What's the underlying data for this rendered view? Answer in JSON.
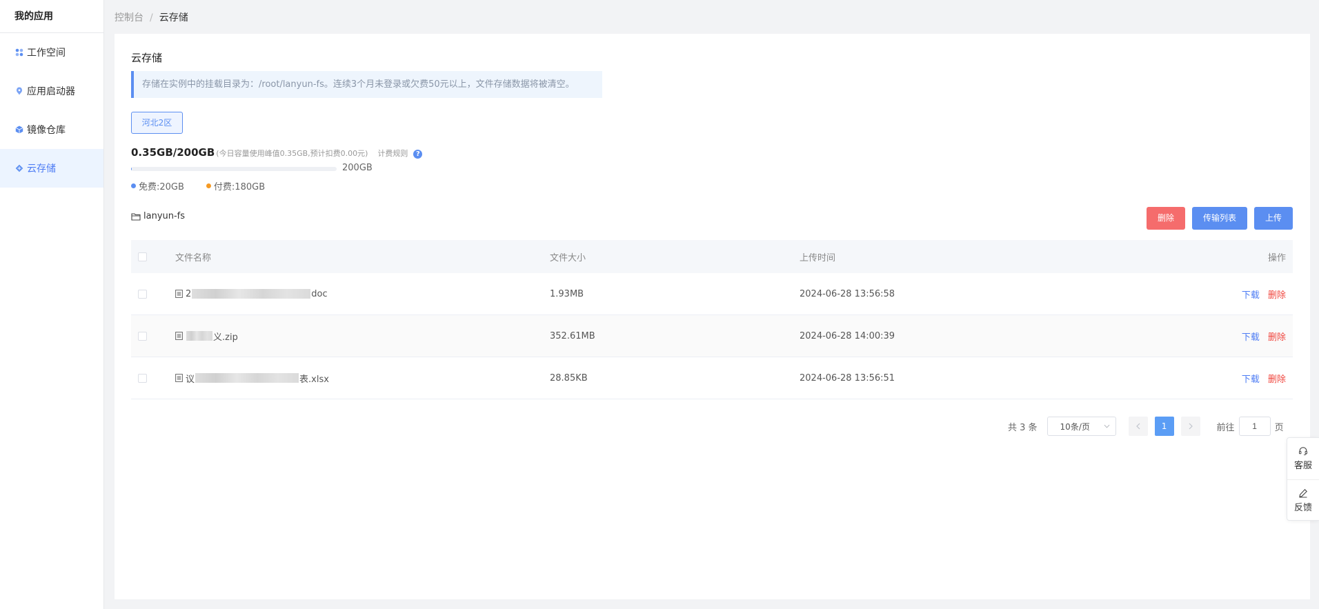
{
  "sidebar": {
    "title": "我的应用",
    "items": [
      {
        "label": "工作空间",
        "icon": "workspace-icon",
        "active": false
      },
      {
        "label": "应用启动器",
        "icon": "launcher-icon",
        "active": false
      },
      {
        "label": "镜像仓库",
        "icon": "image-repo-icon",
        "active": false
      },
      {
        "label": "云存储",
        "icon": "cloud-storage-icon",
        "active": true
      }
    ]
  },
  "breadcrumb": {
    "root": "控制台",
    "separator": "/",
    "current": "云存储"
  },
  "page": {
    "title": "云存储",
    "notice": "存储在实例中的挂载目录为：/root/lanyun-fs。连续3个月未登录或欠费50元以上，文件存储数据将被清空。",
    "region": "河北2区"
  },
  "usage": {
    "summary": "0.35GB/200GB",
    "peak_note": "(今日容量使用峰值0.35GB,预计扣费0.00元)",
    "billing_rule": "计费规则",
    "help": "?",
    "used_fraction": 0.00175,
    "capacity_label": "200GB",
    "legend_free": "免费:20GB",
    "legend_paid": "付费:180GB"
  },
  "colors": {
    "accent": "#5b8ef1",
    "danger": "#f56c6c",
    "free_dot": "#5b8ef1",
    "paid_dot": "#f59a23"
  },
  "folder": {
    "name": "lanyun-fs"
  },
  "actions": {
    "delete": "删除",
    "transfer_list": "传输列表",
    "upload": "上传"
  },
  "table": {
    "headers": {
      "name": "文件名称",
      "size": "文件大小",
      "time": "上传时间",
      "ops": "操作"
    },
    "rows": [
      {
        "name_prefix": "2",
        "name_suffix": "doc",
        "size": "1.93MB",
        "time": "2024-06-28 13:56:58",
        "download": "下载",
        "delete": "删除"
      },
      {
        "name_prefix": "",
        "name_suffix": "义.zip",
        "size": "352.61MB",
        "time": "2024-06-28 14:00:39",
        "download": "下载",
        "delete": "删除"
      },
      {
        "name_prefix": "议",
        "name_suffix": "表.xlsx",
        "size": "28.85KB",
        "time": "2024-06-28 13:56:51",
        "download": "下载",
        "delete": "删除"
      }
    ]
  },
  "pagination": {
    "total": "共 3 条",
    "page_size": "10条/页",
    "current_page": "1",
    "goto_prefix": "前往",
    "goto_value": "1",
    "goto_suffix": "页"
  },
  "float_menu": {
    "service": "客服",
    "feedback": "反馈"
  }
}
